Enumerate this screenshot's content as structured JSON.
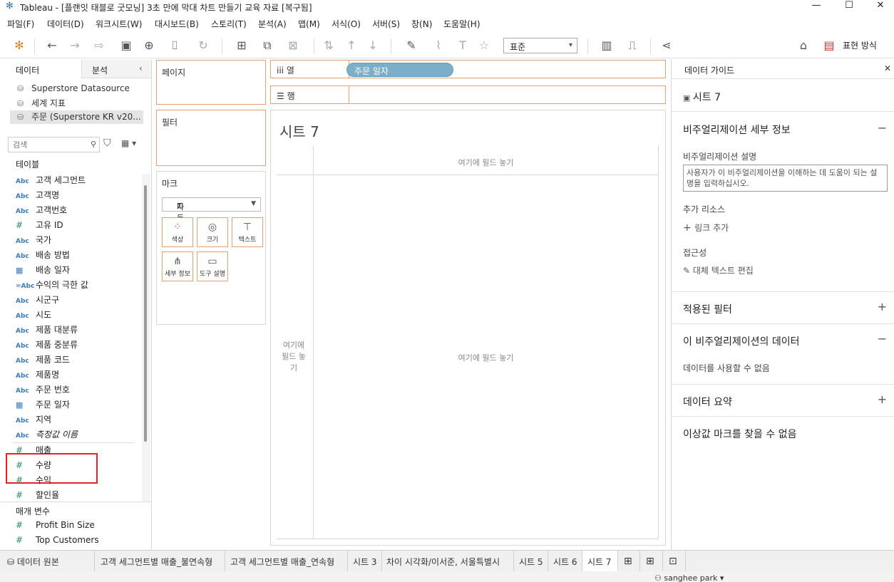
{
  "window": {
    "title": "Tableau - [플랜잇 태블로 굿모닝] 3초 만에 막대 차트 만들기 교육 자료 [복구됨]",
    "min": "—",
    "max": "☐",
    "close": "✕"
  },
  "menu": [
    "파일(F)",
    "데이터(D)",
    "워크시트(W)",
    "대시보드(B)",
    "스토리(T)",
    "분석(A)",
    "맵(M)",
    "서식(O)",
    "서버(S)",
    "창(N)",
    "도움말(H)"
  ],
  "toolbar": {
    "fit": "표준",
    "present": "표현 방식"
  },
  "left": {
    "tab_data": "데이터",
    "tab_analysis": "분석",
    "collapse": "‹",
    "datasources": [
      "Superstore Datasource",
      "세계 지표",
      "주문 (Superstore KR v20..."
    ],
    "search_placeholder": "검색",
    "tables_header": "테이블",
    "fields": [
      {
        "type": "Abc",
        "name": "고객 세그먼트"
      },
      {
        "type": "Abc",
        "name": "고객명"
      },
      {
        "type": "Abc",
        "name": "고객번호"
      },
      {
        "type": "#",
        "name": "고유 ID"
      },
      {
        "type": "Abc",
        "name": "국가"
      },
      {
        "type": "Abc",
        "name": "배송 방법"
      },
      {
        "type": "date",
        "name": "배송 일자"
      },
      {
        "type": "=Abc",
        "name": "수익의 극한 값"
      },
      {
        "type": "Abc",
        "name": "시군구"
      },
      {
        "type": "Abc",
        "name": "시도"
      },
      {
        "type": "Abc",
        "name": "제품 대분류"
      },
      {
        "type": "Abc",
        "name": "제품 중분류"
      },
      {
        "type": "Abc",
        "name": "제품 코드"
      },
      {
        "type": "Abc",
        "name": "제품명"
      },
      {
        "type": "Abc",
        "name": "주문 번호"
      },
      {
        "type": "date",
        "name": "주문 일자"
      },
      {
        "type": "Abc",
        "name": "지역"
      },
      {
        "type": "Abc",
        "name": "측정값 이름"
      }
    ],
    "measures": [
      {
        "type": "#",
        "name": "매출"
      },
      {
        "type": "#",
        "name": "수량"
      },
      {
        "type": "#",
        "name": "수익"
      },
      {
        "type": "#",
        "name": "할인율"
      }
    ],
    "params_header": "매개 변수",
    "params": [
      {
        "type": "#",
        "name": "Profit Bin Size"
      },
      {
        "type": "#",
        "name": "Top Customers"
      }
    ]
  },
  "cards": {
    "pages": "페이지",
    "filters": "필터",
    "marks": "마크",
    "mark_type": "자동",
    "mark_buttons": [
      "색상",
      "크기",
      "텍스트",
      "세부 정보",
      "도구 설명"
    ]
  },
  "shelves": {
    "columns": "열",
    "rows": "행",
    "column_pill": "주문 일자"
  },
  "view": {
    "title": "시트 7",
    "drop_top": "여기에 필드 놓기",
    "drop_center": "여기에 필드 놓기",
    "drop_left": "여기에 필드 놓기"
  },
  "guide": {
    "header": "데이터 가이드",
    "sheet": "시트 7",
    "viz_details": "비주얼리제이션 세부 정보",
    "viz_desc_label": "비주얼리제이션 설명",
    "viz_desc_placeholder": "사용자가 이 비주얼리제이션을 이해하는 데 도움이 되는 설명을 입력하십시오.",
    "extra_resources": "추가 리소스",
    "add_link": "링크 추가",
    "accessibility": "접근성",
    "alt_text": "대체 텍스트 편집",
    "applied_filters": "적용된 필터",
    "viz_data": "이 비주얼리제이션의 데이터",
    "no_data": "데이터를 사용할 수 없음",
    "data_summary": "데이터 요약",
    "no_outliers": "이상값 마크를 찾을 수 없음"
  },
  "tabs": {
    "datasource": "데이터 원본",
    "sheets": [
      "고객 세그먼트별 매출_불연속형",
      "고객 세그먼트별 매출_연속형",
      "시트 3",
      "차이 시각화/이서준, 서울특별시",
      "시트 5",
      "시트 6",
      "시트 7"
    ]
  },
  "status": {
    "user": "sanghee park"
  }
}
